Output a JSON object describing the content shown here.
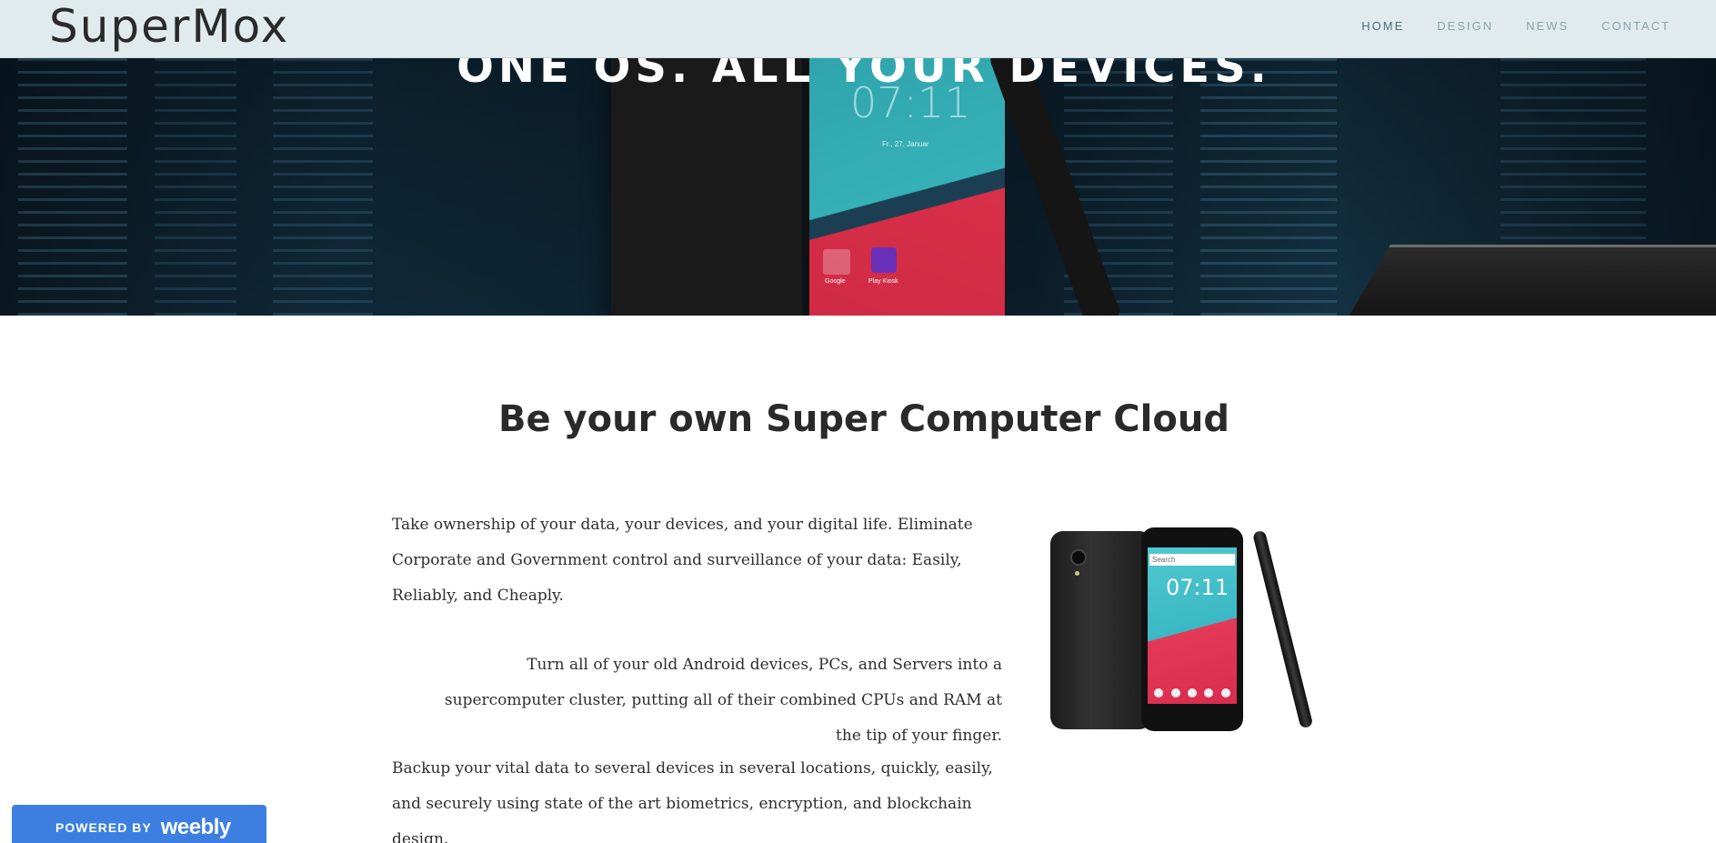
{
  "header": {
    "logo": "SuperMox",
    "nav": [
      {
        "label": "HOME",
        "active": true
      },
      {
        "label": "DESIGN",
        "active": false
      },
      {
        "label": "NEWS",
        "active": false
      },
      {
        "label": "CONTACT",
        "active": false
      }
    ]
  },
  "hero": {
    "title": "ONE OS. ALL YOUR DEVICES.",
    "phone_clock": "07:11",
    "phone_date": "Fr., 27. Januar",
    "app_label_1": "Google",
    "app_label_2": "Play Kiosk"
  },
  "main": {
    "title": "Be your own Super Computer Cloud",
    "paragraph_1": "Take ownership of your data, your devices, and your digital life.  Eliminate Corporate and Government control and surveillance of your data: Easily, Reliably, and Cheaply.",
    "paragraph_2": "Turn all of your old Android devices, PCs, and Servers into a supercomputer cluster, putting all of their combined CPUs and RAM at the tip of your finger.",
    "paragraph_3": "Backup your vital data to several devices in several locations, quickly, easily, and securely using state of the art biometrics, encryption, and blockchain design.",
    "phone_image": {
      "search_placeholder": "Search",
      "clock": "07:11"
    }
  },
  "badge": {
    "powered_by": "POWERED BY",
    "brand": "weebly"
  },
  "colors": {
    "header_bg": "#e1ebed",
    "nav_text": "#8aa2aa",
    "badge_bg": "#3d7fe0",
    "title_text": "#2a2a2a"
  }
}
